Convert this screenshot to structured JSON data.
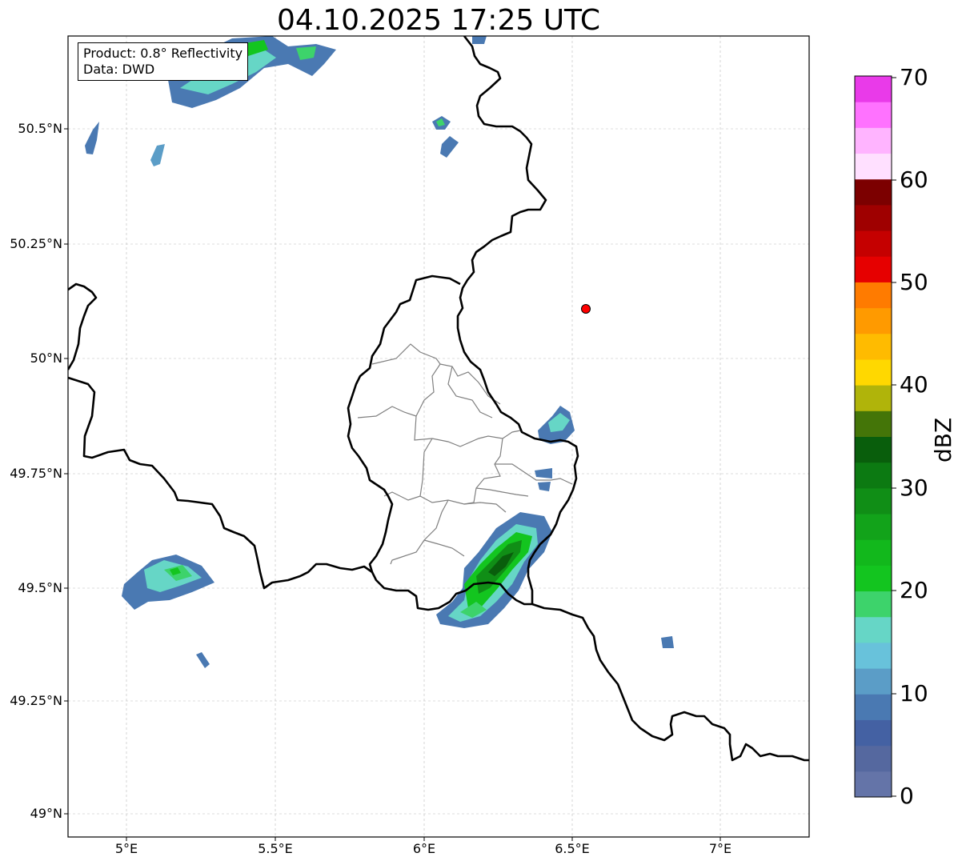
{
  "title": "04.10.2025 17:25 UTC",
  "info": {
    "product": "Product: 0.8° Reflectivity",
    "data_source": "Data: DWD"
  },
  "axes": {
    "lon_labels": [
      "5°E",
      "5.5°E",
      "6°E",
      "6.5°E",
      "7°E"
    ],
    "lat_labels": [
      "50.5°N",
      "50.25°N",
      "50°N",
      "49.75°N",
      "49.5°N",
      "49.25°N",
      "49°N"
    ]
  },
  "colorbar": {
    "unit": "dBZ",
    "tick_labels": [
      "70",
      "60",
      "50",
      "40",
      "30",
      "20",
      "10",
      "0"
    ],
    "colors": [
      "#6474a8",
      "#55689f",
      "#4461a3",
      "#4a79b2",
      "#5b9dc7",
      "#68c2db",
      "#66d6c6",
      "#3dd36b",
      "#13c51f",
      "#12b81c",
      "#12a31a",
      "#108e16",
      "#0c7a12",
      "#095e0c",
      "#447508",
      "#b0b40a",
      "#ffd800",
      "#ffbb00",
      "#ff9a00",
      "#ff7b00",
      "#e60000",
      "#c50000",
      "#9f0000",
      "#7c0000",
      "#ffe0ff",
      "#ffb4ff",
      "#ff72ff",
      "#e93ae9"
    ]
  },
  "marker": {
    "color": "#ff0000"
  }
}
